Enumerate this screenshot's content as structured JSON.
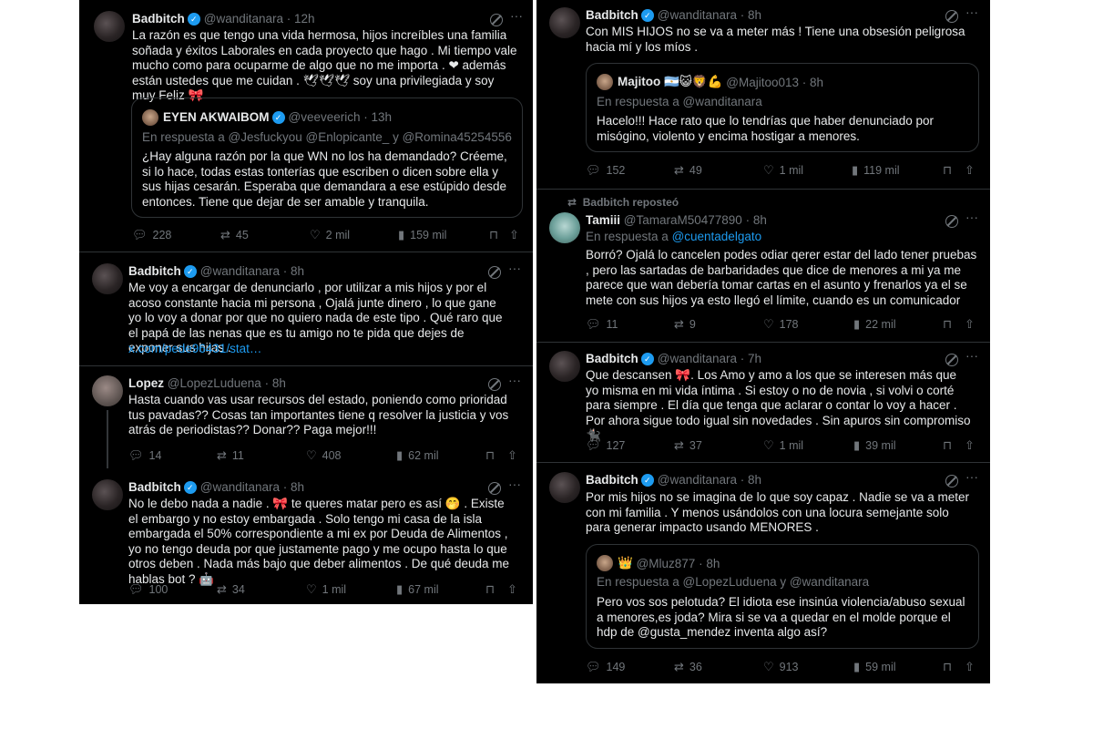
{
  "left": {
    "t1": {
      "name": "Badbitch",
      "handle": "@wanditanara",
      "time": "12h",
      "text": "La razón es que tengo una vida hermosa, hijos increíbles una familia soñada y éxitos Laborales en cada proyecto que hago . Mi tiempo vale mucho como para ocuparme de algo que no me importa . ❤ además están ustedes que me cuidan . 🕊🕊🕊 soy una privilegiada y soy muy Feliz 🎀",
      "quote": {
        "name": "EYEN AKWAIBOM",
        "handle": "@veeveerich",
        "time": "13h",
        "reply_to": "En respuesta a @Jesfuckyou @Enlopicante_ y @Romina45254556",
        "text": "¿Hay alguna razón por la que WN no los ha demandado? Créeme, si lo hace, todas estas tonterías que escriben o dicen sobre ella y sus hijas cesarán. Esperaba que demandara a ese estúpido desde entonces. Tiene que dejar de ser amable y tranquila."
      },
      "replies": "228",
      "reposts": "45",
      "likes": "2 mil",
      "views": "159 mil"
    },
    "t2": {
      "name": "Badbitch",
      "handle": "@wanditanara",
      "time": "8h",
      "text": "Me voy a encargar de denunciarlo , por utilizar a mis hijos y por el acoso constante hacia mi persona , Ojalá junte dinero , lo que gane yo lo voy a donar  por que no quiero nada de este tipo . Qué raro que el papá de las nenas que es tu amigo no te pida que dejes de exponer sus hijas .",
      "link": "x.com/pede96431/stat…"
    },
    "t3": {
      "name": "Lopez",
      "handle": "@LopezLuduena",
      "time": "8h",
      "text": "Hasta cuando vas usar recursos del estado, poniendo como prioridad tus pavadas?? Cosas tan importantes tiene q resolver la justicia y vos atrás de periodistas?? Donar?? Paga mejor!!!",
      "replies": "14",
      "reposts": "11",
      "likes": "408",
      "views": "62 mil"
    },
    "t4": {
      "name": "Badbitch",
      "handle": "@wanditanara",
      "time": "8h",
      "text": "No le debo nada a nadie . 🎀 te queres matar pero es así 🤭 . Existe el embargo y no estoy embargada . Solo tengo mi casa de la isla embargada el 50% correspondiente a mi ex por Deuda de Alimentos , yo no tengo deuda por que justamente pago y me ocupo hasta lo que otros deben . Nada más bajo que deber alimentos . De qué deuda me hablas bot ? 🤖",
      "replies": "100",
      "reposts": "34",
      "likes": "1 mil",
      "views": "67 mil"
    }
  },
  "right": {
    "t1": {
      "name": "Badbitch",
      "handle": "@wanditanara",
      "time": "8h",
      "text": "Con MIS HIJOS no se va a meter más !  Tiene una obsesión peligrosa hacia mí y los míos .",
      "quote": {
        "name": "Majitoo 🇦🇷😺🦁💪",
        "handle": "@Majitoo013",
        "time": "8h",
        "reply_to": "En respuesta a @wanditanara",
        "text": "Hacelo!!! Hace rato que lo tendrías que haber denunciado por misógino, violento y encima hostigar a menores."
      },
      "replies": "152",
      "reposts": "49",
      "likes": "1 mil",
      "views": "119 mil"
    },
    "t2": {
      "repost_label": "Badbitch reposteó",
      "name": "Tamiii",
      "handle": "@TamaraM50477890",
      "time": "8h",
      "reply_to_prefix": "En respuesta a ",
      "reply_to_handle": "@cuentadelgato",
      "text": "Borró? Ojalá lo cancelen podes odiar qerer estar del lado tener pruebas , pero las sartadas de barbaridades que dice de menores a mi ya me parece que wan debería tomar cartas en el asunto y frenarlos ya el se mete con sus hijos ya esto llegó el límite, cuando es un comunicador",
      "replies": "11",
      "reposts": "9",
      "likes": "178",
      "views": "22 mil"
    },
    "t3": {
      "name": "Badbitch",
      "handle": "@wanditanara",
      "time": "7h",
      "text": "Que descansen 🎀. Los Amo y amo a los que se interesen más que yo misma en mi vida íntima . Si estoy o no de novia , si volvi o corté para siempre .  El día que tenga que aclarar o contar lo voy a hacer . Por ahora sigue todo igual sin novedades . Sin apuros sin compromiso 🐈‍⬛",
      "replies": "127",
      "reposts": "37",
      "likes": "1 mil",
      "views": "39 mil"
    },
    "t4": {
      "name": "Badbitch",
      "handle": "@wanditanara",
      "time": "8h",
      "text": "Por mis hijos no se imagina de lo que soy capaz .  Nadie se va a meter con mi familia . Y menos usándolos con una locura semejante solo para generar impacto usando MENORES .",
      "quote": {
        "name": "👑",
        "handle": "@Mluz877",
        "time": "8h",
        "reply_to": "En respuesta a @LopezLuduena y @wanditanara",
        "text": "Pero vos sos pelotuda? El idiota ese insinúa violencia/abuso sexual a menores,es joda? Mira si se va a quedar en el molde porque el hdp de @gusta_mendez inventa algo así?"
      },
      "replies": "149",
      "reposts": "36",
      "likes": "913",
      "views": "59 mil"
    }
  },
  "icons": {
    "reply": "reply-icon",
    "repost": "repost-icon",
    "like": "like-icon",
    "views": "views-icon",
    "bookmark": "bookmark-icon",
    "share": "share-icon",
    "grok": "grok-icon",
    "more": "more-icon",
    "verified": "verified-badge-icon"
  },
  "colors": {
    "background": "#000000",
    "text": "#e7e9ea",
    "muted": "#71767b",
    "accent": "#1d9bf0",
    "border": "#2f3336"
  }
}
